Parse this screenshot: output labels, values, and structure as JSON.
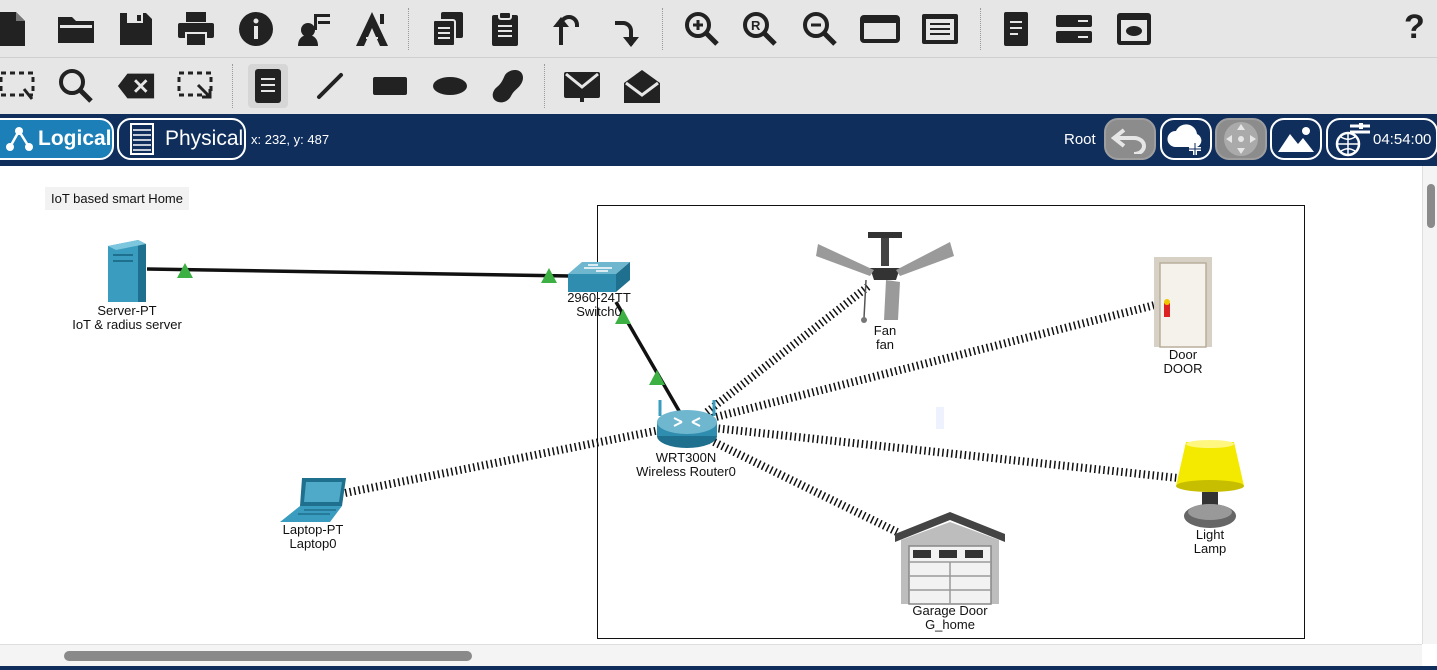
{
  "toolbar_top": {
    "icons": [
      "new-file-icon",
      "open-folder-icon",
      "save-icon",
      "print-icon",
      "info-icon",
      "activity-wizard-icon",
      "custom-pdu-wizard-icon",
      "copy-icon",
      "paste-icon",
      "undo-icon",
      "redo-icon",
      "zoom-in-icon",
      "zoom-reset-icon",
      "zoom-out-icon",
      "drawing-palette-icon",
      "custom-devices-icon",
      "viewport-icon",
      "device-list-icon",
      "screenshot-icon"
    ],
    "help_label": "?"
  },
  "toolbar_second": {
    "icons": [
      "select-icon",
      "inspect-icon",
      "delete-icon",
      "resize-shape-icon",
      "place-note-icon",
      "draw-line-icon",
      "draw-rectangle-icon",
      "draw-ellipse-icon",
      "draw-freeform-icon",
      "add-simple-pdu-icon",
      "add-complex-pdu-icon"
    ]
  },
  "navbar": {
    "logical_label": "Logical",
    "physical_label": "Physical",
    "coords": "x: 232, y: 487",
    "root_label": "Root",
    "time": "04:54:00"
  },
  "canvas": {
    "note": "IoT based smart Home",
    "devices": {
      "server": {
        "type": "Server-PT",
        "name": "IoT & radius server"
      },
      "switch": {
        "type": "2960-24TT",
        "name": "Switch0"
      },
      "router": {
        "type": "WRT300N",
        "name": "Wireless Router0"
      },
      "laptop": {
        "type": "Laptop-PT",
        "name": "Laptop0"
      },
      "fan": {
        "type": "Fan",
        "name": "fan"
      },
      "door": {
        "type": "Door",
        "name": "DOOR"
      },
      "lamp": {
        "type": "Light",
        "name": "Lamp"
      },
      "garage": {
        "type": "Garage Door",
        "name": "G_home"
      }
    }
  },
  "colors": {
    "navbar": "#0f2e5c",
    "logical_tab": "#1c7fb8",
    "link_up": "#3cb043",
    "toolbar": "#e6e6e6"
  }
}
